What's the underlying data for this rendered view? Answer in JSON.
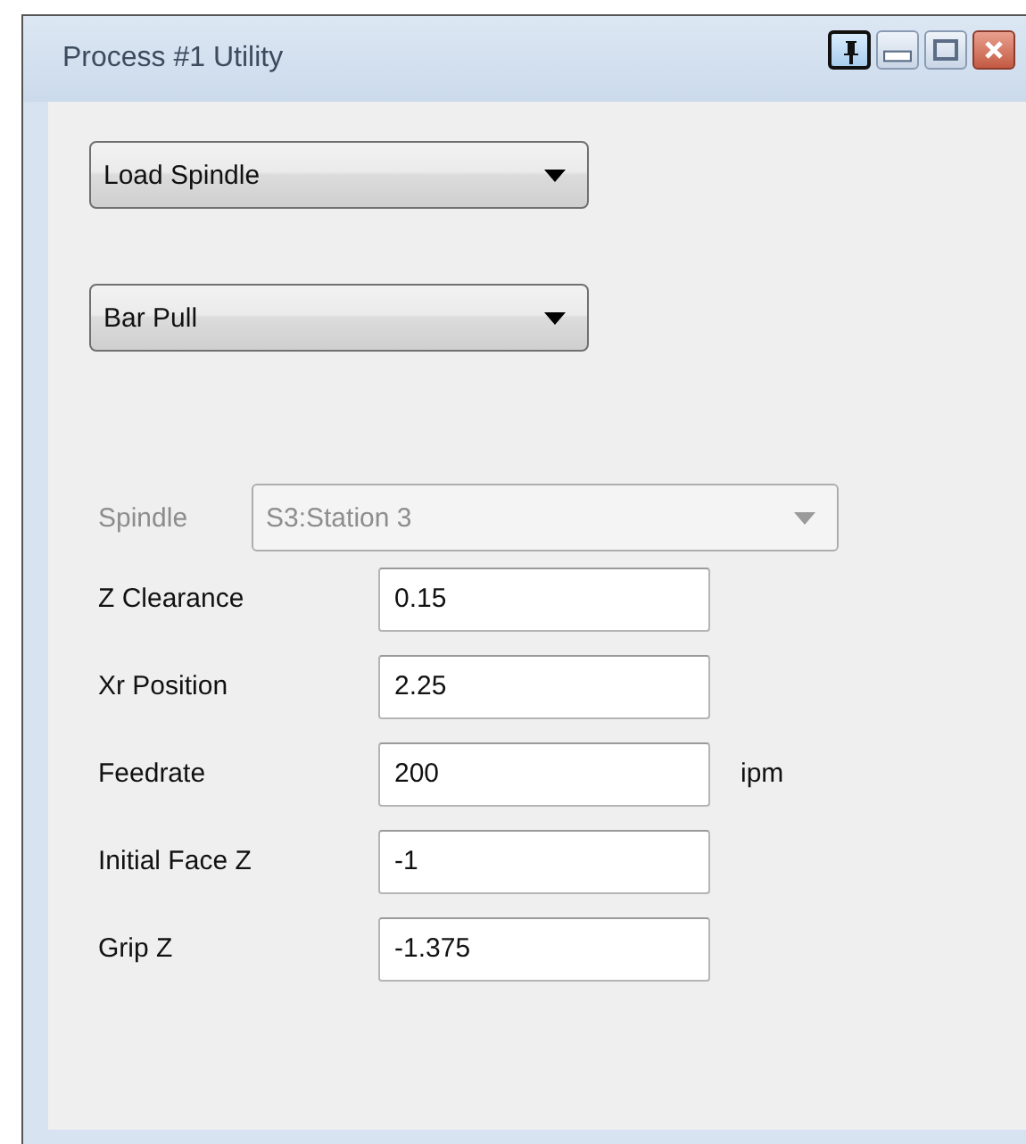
{
  "window": {
    "title": "Process #1 Utility",
    "pinned": true
  },
  "dropdowns": [
    {
      "value": "Load Spindle"
    },
    {
      "value": "Bar Pull"
    }
  ],
  "spindle": {
    "label": "Spindle",
    "value": "S3:Station 3",
    "disabled": true
  },
  "fields": [
    {
      "label": "Z Clearance",
      "value": "0.15"
    },
    {
      "label": "Xr Position",
      "value": "2.25"
    },
    {
      "label": "Feedrate",
      "value": "200",
      "unit": "ipm"
    },
    {
      "label": "Initial Face Z",
      "value": "-1"
    },
    {
      "label": "Grip Z",
      "value": "-1.375"
    }
  ]
}
